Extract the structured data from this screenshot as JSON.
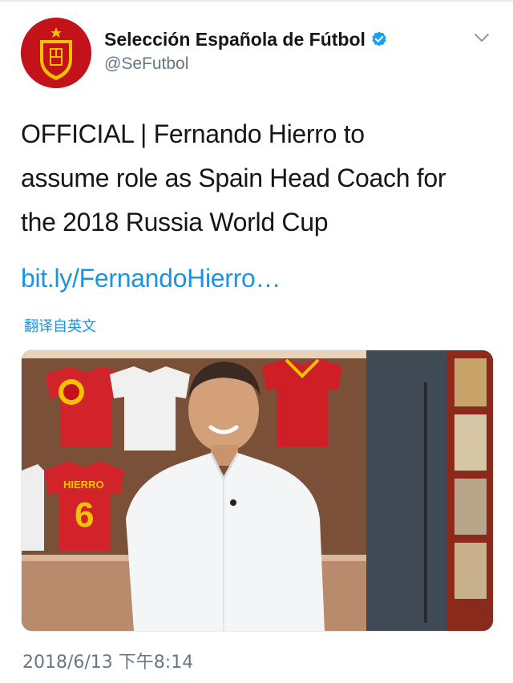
{
  "tweet": {
    "author": {
      "display_name": "Selección Española de Fútbol",
      "handle": "@SeFutbol",
      "verified": true,
      "avatar_icon": "rfef-crest-icon"
    },
    "menu_icon": "chevron-down-icon",
    "text_lines": [
      "OFFICIAL | Fernando Hierro to",
      "assume role as Spain Head Coach for",
      "the 2018 Russia World Cup"
    ],
    "link": "bit.ly/FernandoHierro…",
    "translate_label": "翻译自英文",
    "timestamp": "2018/6/13 下午8:14",
    "photo": {
      "jersey_name": "HIERRO",
      "jersey_number": "6"
    }
  },
  "colors": {
    "link_blue": "#1b95e0",
    "secondary_gray": "#657786",
    "text_dark": "#14171a",
    "avatar_red": "#c4121a",
    "verified_blue": "#1da1f2"
  }
}
